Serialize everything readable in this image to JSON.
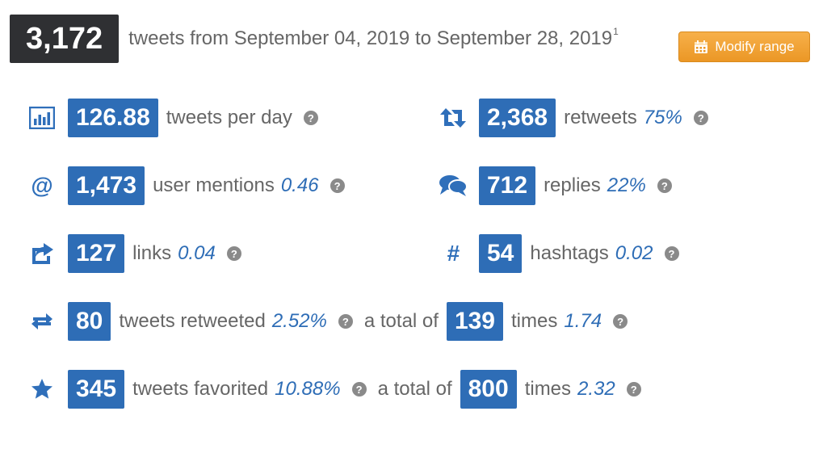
{
  "header": {
    "total_tweets": "3,172",
    "range_text": "tweets from September 04, 2019 to September 28, 2019",
    "footnote": "1",
    "modify_button": "Modify range",
    "button_color": "#f0a030"
  },
  "help_glyph": "?",
  "accent_color": "#2e6db6",
  "stats": {
    "tweets_per_day": {
      "value": "126.88",
      "label": "tweets per day",
      "icon": "bar-chart-icon"
    },
    "retweets": {
      "value": "2,368",
      "label": "retweets",
      "extra": "75%",
      "icon": "retweet-icon"
    },
    "user_mentions": {
      "value": "1,473",
      "label": "user mentions",
      "extra": "0.46",
      "icon": "at-icon",
      "icon_glyph": "@"
    },
    "replies": {
      "value": "712",
      "label": "replies",
      "extra": "22%",
      "icon": "comments-icon"
    },
    "links": {
      "value": "127",
      "label": "links",
      "extra": "0.04",
      "icon": "share-icon"
    },
    "hashtags": {
      "value": "54",
      "label": "hashtags",
      "extra": "0.02",
      "icon": "hashtag-icon",
      "icon_glyph": "#"
    },
    "tweets_retweeted": {
      "value": "80",
      "label": "tweets retweeted",
      "extra": "2.52%",
      "mid_text": "a total of",
      "total": "139",
      "times_label": "times",
      "times_value": "1.74",
      "icon": "retweet-arrows-icon"
    },
    "tweets_favorited": {
      "value": "345",
      "label": "tweets favorited",
      "extra": "10.88%",
      "mid_text": "a total of",
      "total": "800",
      "times_label": "times",
      "times_value": "2.32",
      "icon": "star-icon"
    }
  }
}
